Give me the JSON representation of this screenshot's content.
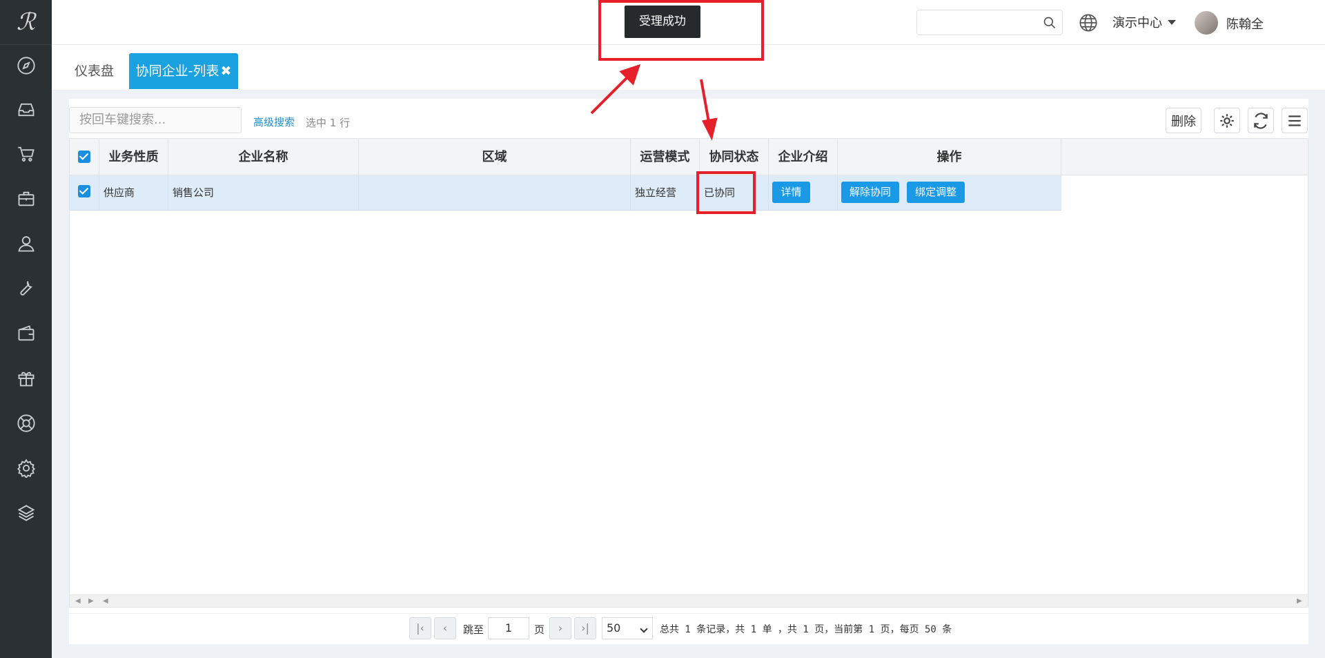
{
  "app": {
    "logo_text": "ℛ"
  },
  "sidebar": {
    "icons": [
      "compass-icon",
      "inbox-icon",
      "cart-icon",
      "briefcase-icon",
      "user-icon",
      "wrench-icon",
      "wallet-icon",
      "gift-icon",
      "lifebuoy-icon",
      "gear-icon",
      "layers-icon"
    ]
  },
  "topbar": {
    "search_placeholder": "",
    "center_label": "演示中心",
    "username": "陈翰全",
    "help_label": "?"
  },
  "tabs": [
    {
      "label": "仪表盘"
    },
    {
      "label": "协同企业-列表",
      "close": "✖"
    }
  ],
  "toolbar": {
    "search_placeholder": "按回车键搜索...",
    "advanced_search": "高级搜索",
    "selected_info": "选中 1 行",
    "delete_label": "删除"
  },
  "table": {
    "headers": [
      "业务性质",
      "企业名称",
      "区域",
      "运营模式",
      "协同状态",
      "企业介绍",
      "操作"
    ],
    "rows": [
      {
        "business_type": "供应商",
        "company_name": "销售公司",
        "region": "",
        "operation_mode": "独立经营",
        "sync_status": "已协同",
        "intro_button": "详情",
        "action_unbind": "解除协同",
        "action_adjust": "绑定调整"
      }
    ]
  },
  "pagination": {
    "jump_label": "跳至",
    "page_input": "1",
    "page_label": "页",
    "page_size": "50",
    "summary": "总共 1 条记录，共 1 单 ，共 1 页，当前第 1 页，每页 50 条"
  },
  "toast": {
    "message": "受理成功"
  },
  "annotation_color": "#e5202a"
}
